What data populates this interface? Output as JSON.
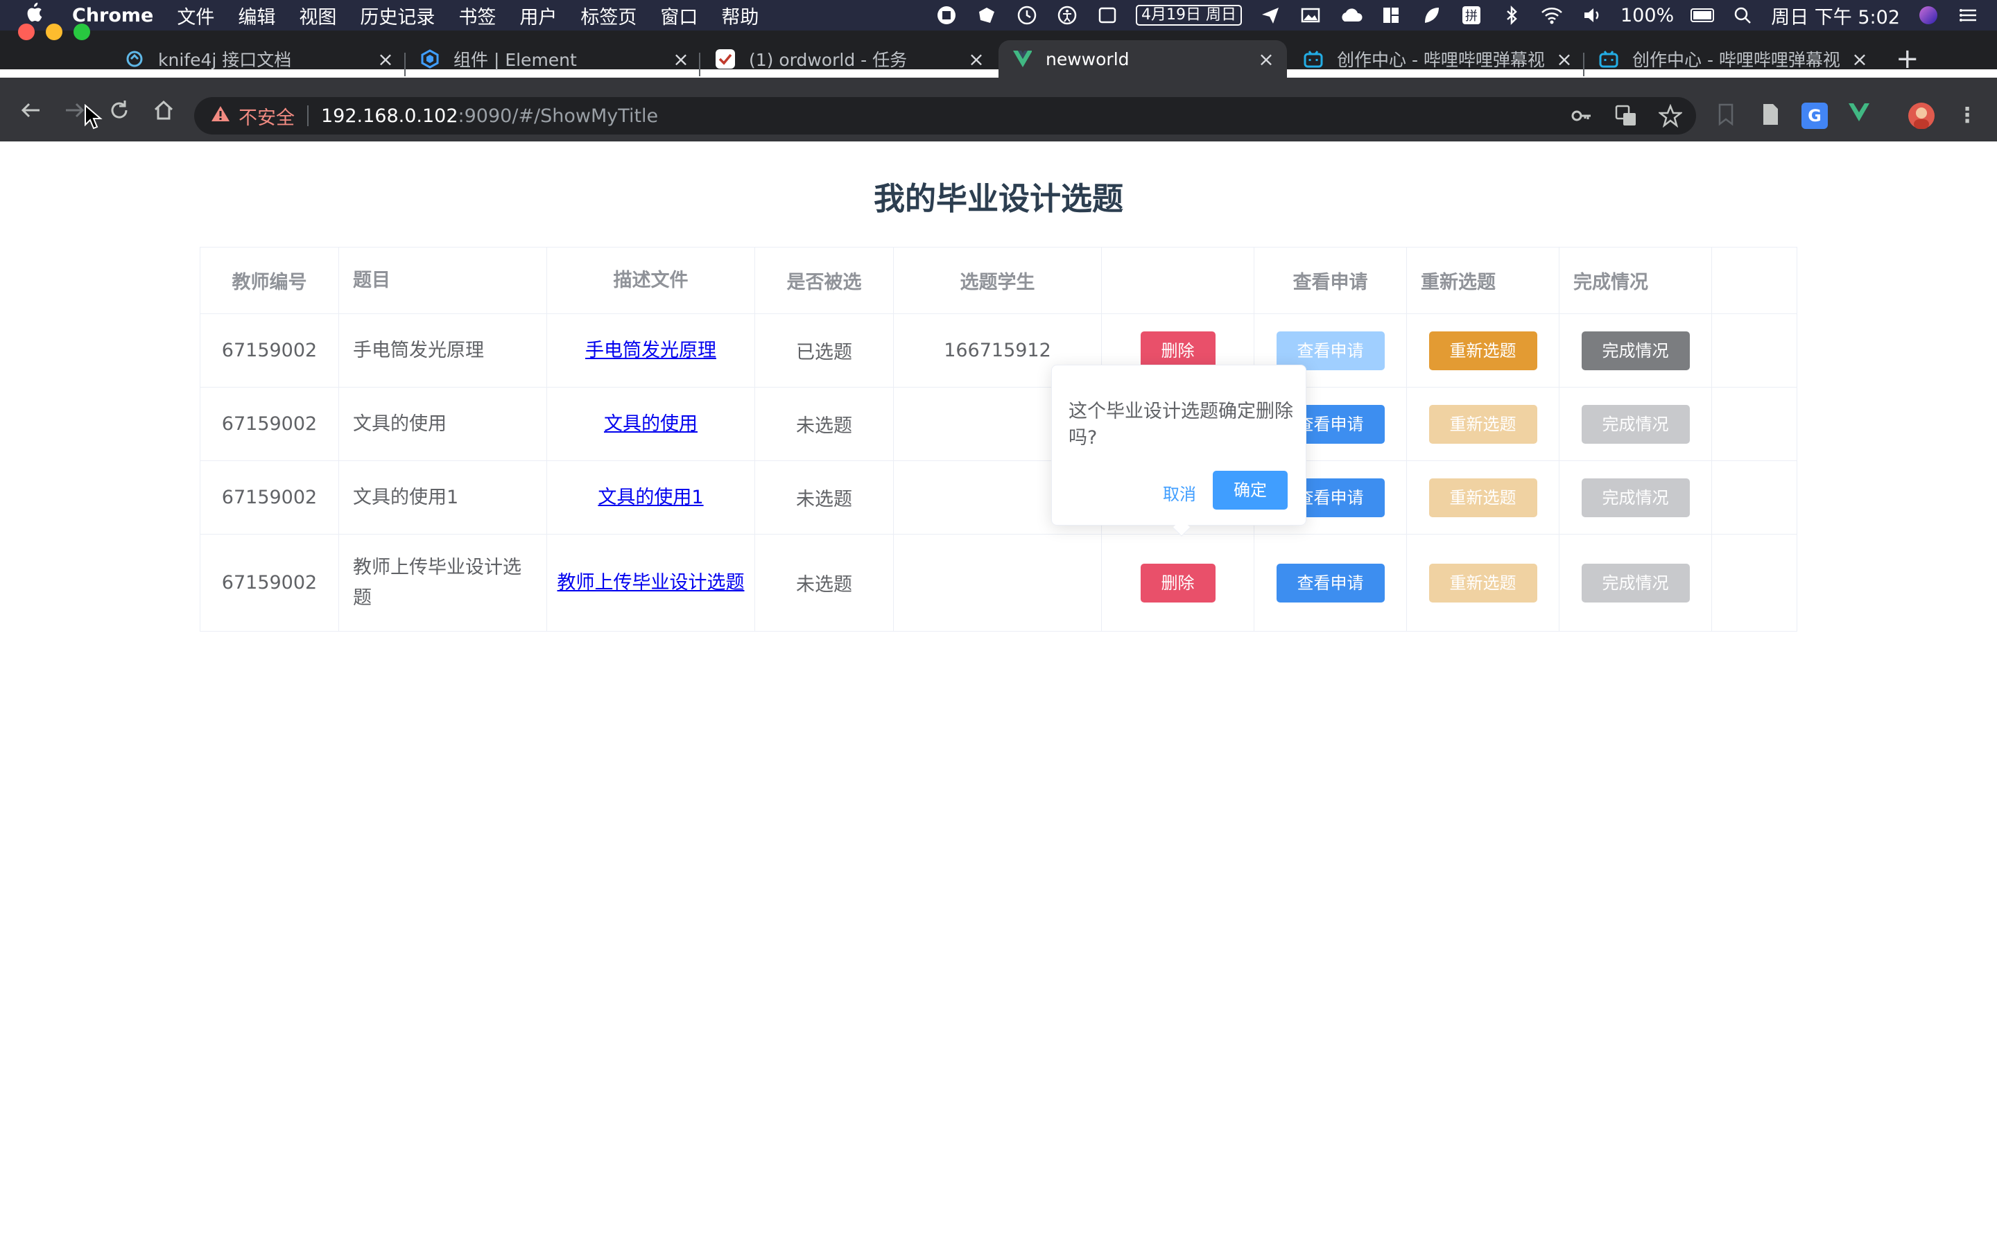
{
  "menubar": {
    "app_name": "Chrome",
    "items": [
      "文件",
      "编辑",
      "视图",
      "历史记录",
      "书签",
      "用户",
      "标签页",
      "窗口",
      "帮助"
    ],
    "date_badge": "4月19日 周日",
    "input_method": "拼",
    "battery": "100%",
    "clock": "周日 下午 5:02"
  },
  "tabs": [
    {
      "title": "knife4j 接口文档",
      "icon": "knife4j-icon",
      "active": false
    },
    {
      "title": "组件 | Element",
      "icon": "element-icon",
      "active": false
    },
    {
      "title": "(1) ordworld - 任务",
      "icon": "task-icon",
      "active": false
    },
    {
      "title": "newworld",
      "icon": "vue-icon",
      "active": true
    },
    {
      "title": "创作中心 - 哔哩哔哩弹幕视",
      "icon": "bilibili-icon",
      "active": false
    },
    {
      "title": "创作中心 - 哔哩哔哩弹幕视",
      "icon": "bilibili-icon",
      "active": false
    }
  ],
  "address": {
    "security_label": "不安全",
    "host": "192.168.0.102",
    "rest": ":9090/#/ShowMyTitle"
  },
  "page": {
    "title": "我的毕业设计选题",
    "columns": [
      "教师编号",
      "题目",
      "描述文件",
      "是否被选",
      "选题学生",
      "",
      "查看申请",
      "重新选题",
      "完成情况"
    ],
    "rows": [
      {
        "teacher_id": "67159002",
        "title": "手电筒发光原理",
        "file": "手电筒发光原理",
        "selected": "已选题",
        "student": "166715912"
      },
      {
        "teacher_id": "67159002",
        "title": "文具的使用",
        "file": "文具的使用",
        "selected": "未选题",
        "student": ""
      },
      {
        "teacher_id": "67159002",
        "title": "文具的使用1",
        "file": "文具的使用1",
        "selected": "未选题",
        "student": ""
      },
      {
        "teacher_id": "67159002",
        "title": "教师上传毕业设计选题",
        "file": "教师上传毕业设计选题",
        "selected": "未选题",
        "student": ""
      }
    ],
    "buttons": {
      "delete": "删除",
      "view_apply": "查看申请",
      "reselect": "重新选题",
      "completion": "完成情况"
    },
    "popconfirm": {
      "message": "这个毕业设计选题确定删除吗?",
      "cancel": "取消",
      "confirm": "确定"
    }
  }
}
